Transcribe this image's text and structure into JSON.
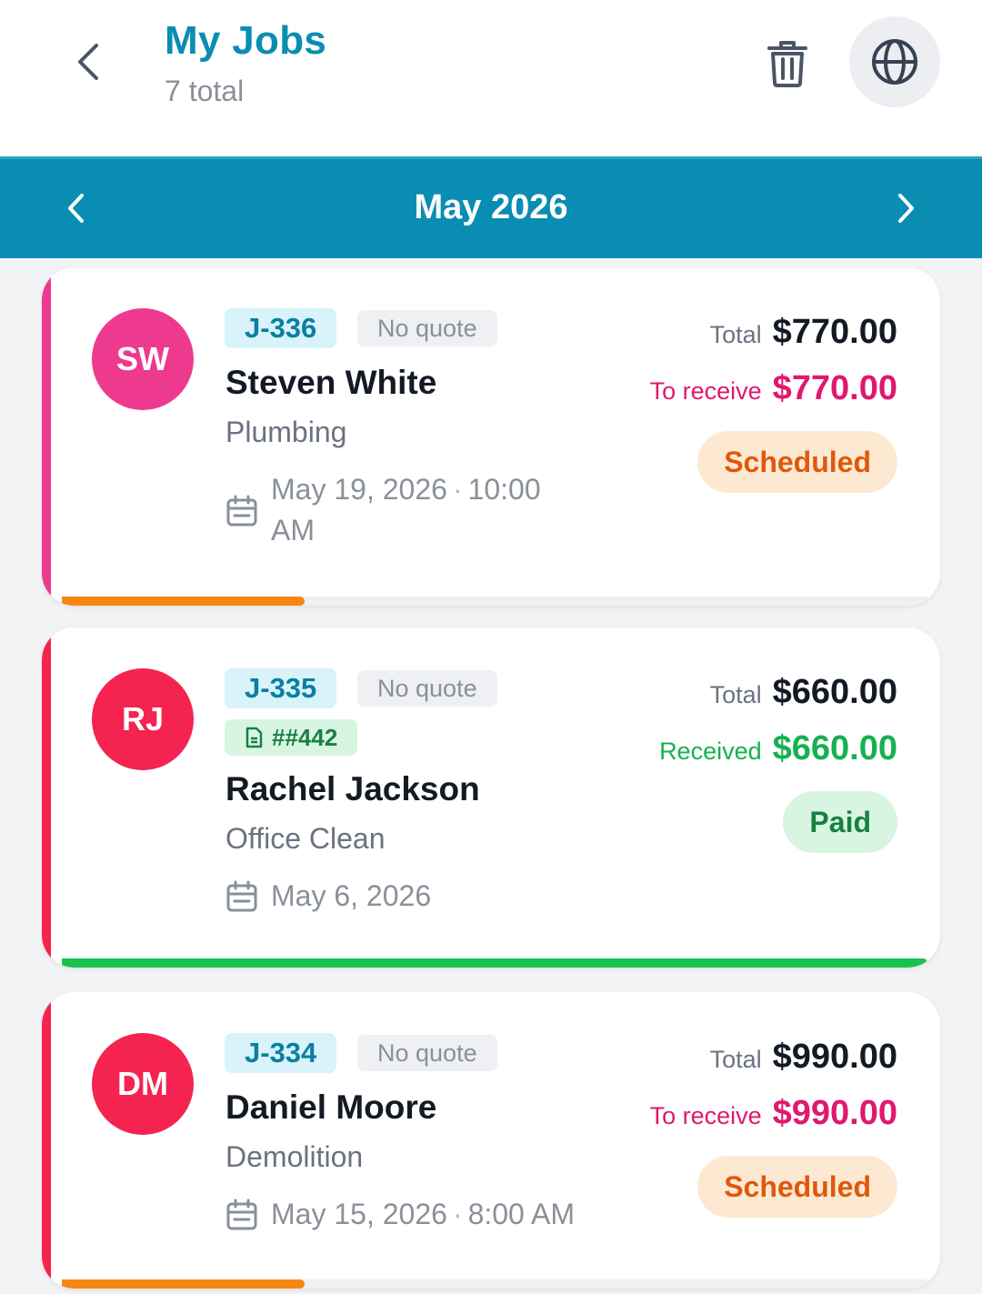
{
  "header": {
    "title": "My Jobs",
    "subtitle": "7 total",
    "back_icon": "chevron-left-icon",
    "trash_icon": "trash-icon",
    "globe_icon": "globe-icon"
  },
  "month_nav": {
    "label": "May 2026",
    "prev_icon": "chevron-left-icon",
    "next_icon": "chevron-right-icon"
  },
  "colors": {
    "brand": "#0a8db3",
    "pink_accent": "#ee3a8e",
    "red_accent": "#f5234f",
    "progress_orange": "#f7870f",
    "progress_green": "#18c24e"
  },
  "jobs": [
    {
      "initials": "SW",
      "avatar_color": "#ee3a8e",
      "job_id": "J-336",
      "quote": "No quote",
      "name": "Steven White",
      "service": "Plumbing",
      "date": "May 19, 2026",
      "dot": "·",
      "time": "10:00 AM",
      "total_label": "Total",
      "total": "$770.00",
      "balance_label": "To receive",
      "balance": "$770.00",
      "status": "Scheduled",
      "progress": 0.28
    },
    {
      "initials": "RJ",
      "avatar_color": "#f5234f",
      "job_id": "J-335",
      "quote": "No quote",
      "invoice": "##442",
      "name": "Rachel Jackson",
      "service": "Office Clean",
      "date": "May 6, 2026",
      "total_label": "Total",
      "total": "$660.00",
      "balance_label": "Received",
      "balance": "$660.00",
      "status": "Paid",
      "progress": 1.0
    },
    {
      "initials": "DM",
      "avatar_color": "#f5234f",
      "job_id": "J-334",
      "quote": "No quote",
      "name": "Daniel Moore",
      "service": "Demolition",
      "date": "May 15, 2026",
      "dot": "·",
      "time": "8:00 AM",
      "total_label": "Total",
      "total": "$990.00",
      "balance_label": "To receive",
      "balance": "$990.00",
      "status": "Scheduled",
      "progress": 0.28
    }
  ]
}
